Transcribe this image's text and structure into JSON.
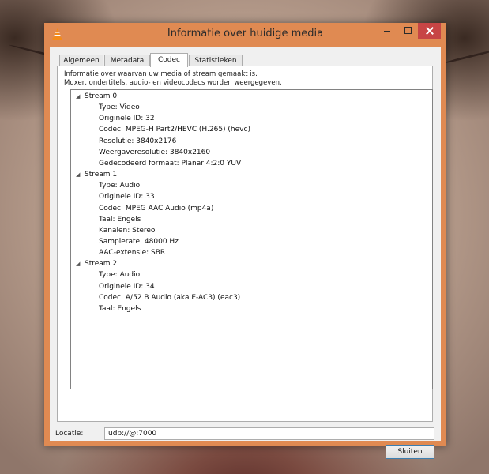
{
  "window": {
    "title": "Informatie over huidige media",
    "icon": "vlc-cone-icon",
    "accent_color": "#e08a52",
    "close_color": "#c74545"
  },
  "tabs": [
    {
      "label": "Algemeen",
      "active": false
    },
    {
      "label": "Metadata",
      "active": false
    },
    {
      "label": "Codec",
      "active": true
    },
    {
      "label": "Statistieken",
      "active": false
    }
  ],
  "info": {
    "line1": "Informatie over waarvan uw media of stream gemaakt is.",
    "line2": "Muxer, ondertitels, audio- en videocodecs worden weergegeven."
  },
  "streams": [
    {
      "label": "Stream 0",
      "props": [
        "Type: Video",
        "Originele ID: 32",
        "Codec: MPEG-H Part2/HEVC (H.265) (hevc)",
        "Resolutie: 3840x2176",
        "Weergaveresolutie: 3840x2160",
        "Gedecodeerd formaat: Planar 4:2:0 YUV"
      ]
    },
    {
      "label": "Stream 1",
      "props": [
        "Type: Audio",
        "Originele ID: 33",
        "Codec: MPEG AAC Audio (mp4a)",
        "Taal: Engels",
        "Kanalen: Stereo",
        "Samplerate: 48000 Hz",
        "AAC-extensie: SBR"
      ]
    },
    {
      "label": "Stream 2",
      "props": [
        "Type: Audio",
        "Originele ID: 34",
        "Codec: A/52 B Audio (aka E-AC3) (eac3)",
        "Taal: Engels"
      ]
    }
  ],
  "location": {
    "label": "Locatie:",
    "value": "udp://@:7000"
  },
  "buttons": {
    "close": "Sluiten"
  }
}
